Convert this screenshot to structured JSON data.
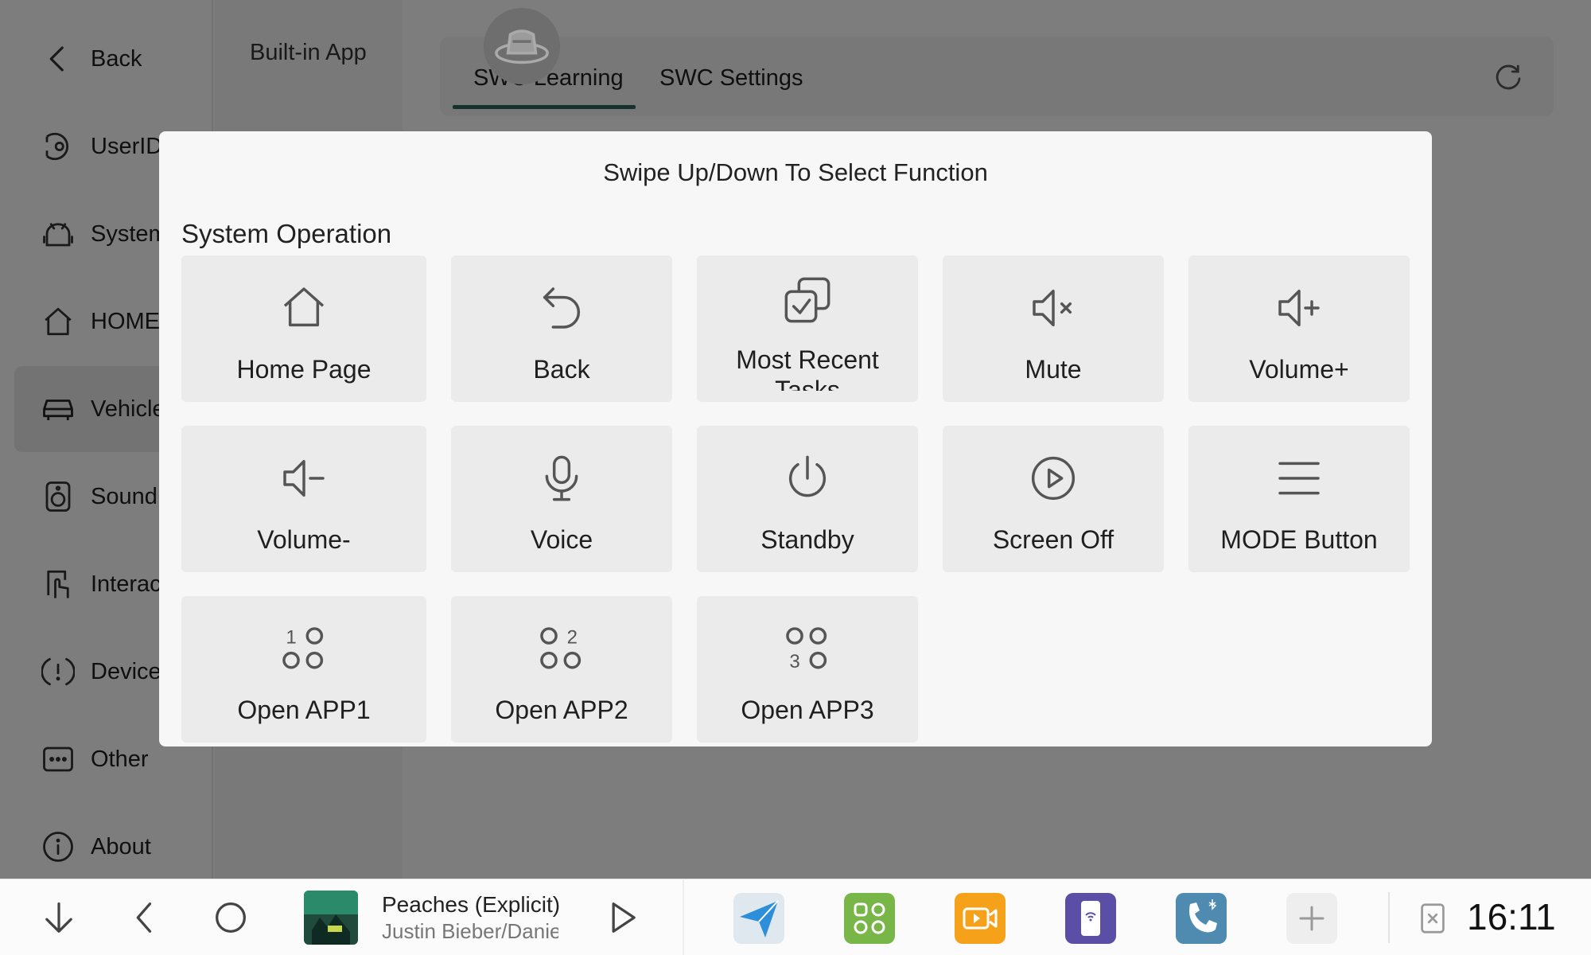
{
  "sidebar": {
    "items": [
      {
        "label": "Back",
        "icon": "chevron-left-icon"
      },
      {
        "label": "UserID",
        "icon": "user-id-icon"
      },
      {
        "label": "System",
        "icon": "android-icon"
      },
      {
        "label": "HOME",
        "icon": "home-icon"
      },
      {
        "label": "Vehicle",
        "icon": "car-icon",
        "active": true
      },
      {
        "label": "Sound",
        "icon": "speaker-icon"
      },
      {
        "label": "Interact",
        "icon": "touch-icon"
      },
      {
        "label": "Device",
        "icon": "alert-icon"
      },
      {
        "label": "Other",
        "icon": "more-dots-icon"
      },
      {
        "label": "About",
        "icon": "info-icon"
      }
    ]
  },
  "subnav": {
    "item": "Built-in App"
  },
  "tabs": {
    "learning": "SWC Learning",
    "settings": "SWC Settings"
  },
  "modal": {
    "title": "Swipe Up/Down To Select Function",
    "section": "System Operation",
    "functions": [
      {
        "label": "Home Page",
        "icon": "home-icon"
      },
      {
        "label": "Back",
        "icon": "undo-arrow-icon"
      },
      {
        "label": "Most Recent Tasks",
        "icon": "recent-tasks-icon"
      },
      {
        "label": "Mute",
        "icon": "mute-icon"
      },
      {
        "label": "Volume+",
        "icon": "volume-up-icon"
      },
      {
        "label": "Volume-",
        "icon": "volume-down-icon"
      },
      {
        "label": "Voice",
        "icon": "microphone-icon"
      },
      {
        "label": "Standby",
        "icon": "power-icon"
      },
      {
        "label": "Screen Off",
        "icon": "play-circle-icon"
      },
      {
        "label": "MODE Button",
        "icon": "menu-icon"
      },
      {
        "label": "Open APP1",
        "icon": "app-grid-1-icon",
        "digit": "1"
      },
      {
        "label": "Open APP2",
        "icon": "app-grid-2-icon",
        "digit": "2"
      },
      {
        "label": "Open APP3",
        "icon": "app-grid-3-icon",
        "digit": "3"
      }
    ]
  },
  "taskbar": {
    "music": {
      "title": "Peaches (Explicit)",
      "artist": "Justin Bieber/Daniel Caesar/Giveon"
    },
    "apps": [
      {
        "name": "navigation-app-icon",
        "color": "#dfe8ee"
      },
      {
        "name": "apps-grid-app-icon",
        "color": "#79b648"
      },
      {
        "name": "video-app-icon",
        "color": "#f5a21a"
      },
      {
        "name": "phone-mirror-app-icon",
        "color": "#5b4ea6"
      },
      {
        "name": "bluetooth-phone-app-icon",
        "color": "#4f8bb0"
      },
      {
        "name": "add-app-icon",
        "color": "#eeeeee"
      }
    ],
    "clock": "16:11"
  },
  "colors": {
    "accent": "#2f6358",
    "tile": "#ebebeb",
    "modal": "#f7f7f7"
  }
}
